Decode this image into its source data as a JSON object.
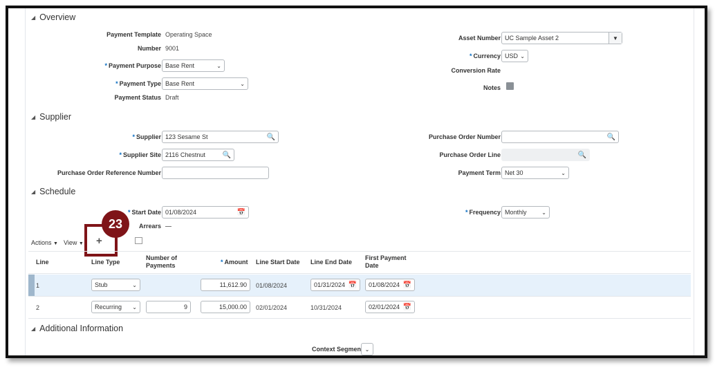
{
  "sections": {
    "overview": "Overview",
    "supplier": "Supplier",
    "schedule": "Schedule",
    "additional": "Additional Information"
  },
  "overview": {
    "payment_template_label": "Payment Template",
    "payment_template_value": "Operating Space",
    "number_label": "Number",
    "number_value": "9001",
    "payment_purpose_label": "Payment Purpose",
    "payment_purpose_value": "Base Rent",
    "payment_type_label": "Payment Type",
    "payment_type_value": "Base Rent",
    "payment_status_label": "Payment Status",
    "payment_status_value": "Draft",
    "asset_number_label": "Asset Number",
    "asset_number_value": "UC Sample Asset 2",
    "currency_label": "Currency",
    "currency_value": "USD",
    "conversion_rate_label": "Conversion Rate",
    "notes_label": "Notes"
  },
  "supplier": {
    "supplier_label": "Supplier",
    "supplier_value": "123 Sesame St",
    "supplier_site_label": "Supplier Site",
    "supplier_site_value": "2116 Chestnut",
    "po_ref_label": "Purchase Order Reference Number",
    "po_ref_value": "",
    "po_number_label": "Purchase Order Number",
    "po_number_value": "",
    "po_line_label": "Purchase Order Line",
    "payment_term_label": "Payment Term",
    "payment_term_value": "Net 30"
  },
  "schedule": {
    "start_date_label": "Start Date",
    "start_date_value": "01/08/2024",
    "arrears_label": "Arrears",
    "frequency_label": "Frequency",
    "frequency_value": "Monthly"
  },
  "toolbar": {
    "actions": "Actions",
    "view": "View"
  },
  "callout": "23",
  "table": {
    "headers": {
      "line": "Line",
      "line_type": "Line Type",
      "num_payments": "Number of Payments",
      "amount": "Amount",
      "start": "Line Start Date",
      "end": "Line End Date",
      "first": "First Payment Date"
    },
    "rows": [
      {
        "line": "1",
        "line_type": "Stub",
        "num_payments": "",
        "amount": "11,612.90",
        "start": "01/08/2024",
        "end": "01/31/2024",
        "first": "01/08/2024"
      },
      {
        "line": "2",
        "line_type": "Recurring",
        "num_payments": "9",
        "amount": "15,000.00",
        "start": "02/01/2024",
        "end": "10/31/2024",
        "first": "02/01/2024"
      }
    ]
  },
  "additional": {
    "context_segment_label": "Context Segment"
  }
}
